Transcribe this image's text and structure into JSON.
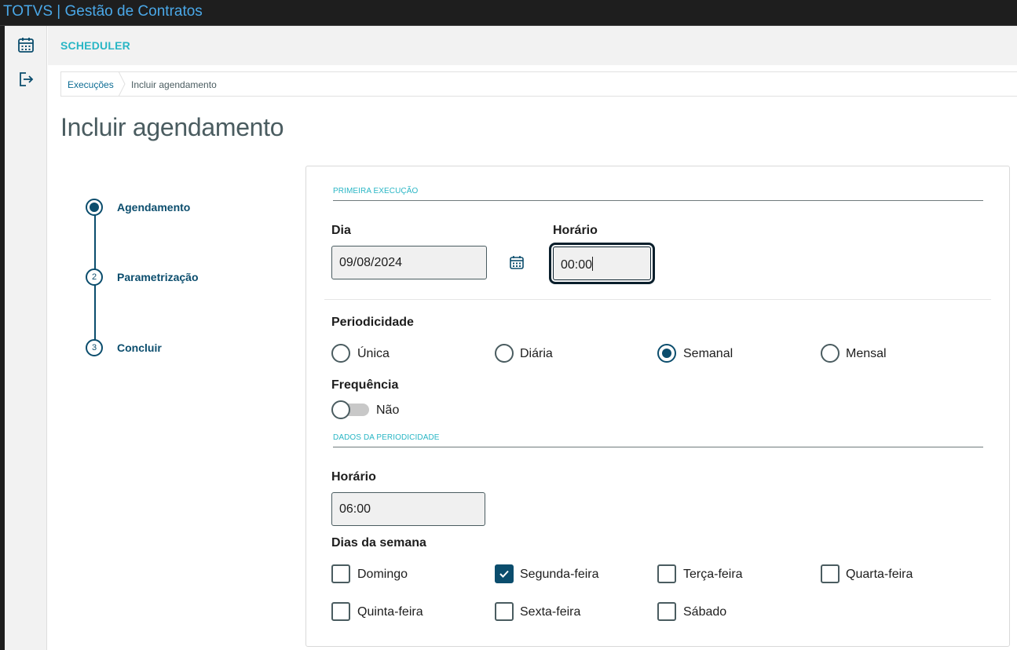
{
  "app": {
    "title": "TOTVS | Gestão de Contratos"
  },
  "sidebar": {
    "items": [
      {
        "icon": "calendar-icon"
      },
      {
        "icon": "logout-icon"
      }
    ]
  },
  "header": {
    "title": "SCHEDULER"
  },
  "breadcrumb": {
    "items": [
      "Execuções",
      "Incluir agendamento"
    ]
  },
  "page": {
    "title": "Incluir agendamento"
  },
  "stepper": {
    "steps": [
      {
        "number": "1",
        "label": "Agendamento",
        "state": "active"
      },
      {
        "number": "2",
        "label": "Parametrização",
        "state": "pending"
      },
      {
        "number": "3",
        "label": "Concluir",
        "state": "pending"
      }
    ]
  },
  "form": {
    "first_execution": {
      "section_title": "PRIMEIRA EXECUÇÃO",
      "day_label": "Dia",
      "day_value": "09/08/2024",
      "time_label": "Horário",
      "time_value": "00:00"
    },
    "periodicity": {
      "label": "Periodicidade",
      "options": [
        "Única",
        "Diária",
        "Semanal",
        "Mensal"
      ],
      "selected": "Semanal"
    },
    "frequency": {
      "label": "Frequência",
      "toggle_value": "Não"
    },
    "periodicity_data": {
      "section_title": "DADOS DA PERIODICIDADE",
      "time_label": "Horário",
      "time_value": "06:00",
      "weekdays_label": "Dias da semana",
      "weekdays": [
        {
          "label": "Domingo",
          "checked": false
        },
        {
          "label": "Segunda-feira",
          "checked": true
        },
        {
          "label": "Terça-feira",
          "checked": false
        },
        {
          "label": "Quarta-feira",
          "checked": false
        },
        {
          "label": "Quinta-feira",
          "checked": false
        },
        {
          "label": "Sexta-feira",
          "checked": false
        },
        {
          "label": "Sábado",
          "checked": false
        }
      ]
    }
  },
  "colors": {
    "primary": "#0b4d6d",
    "accent": "#29b6c5",
    "link": "#0c6c94",
    "title_bar_text": "#4aa8e8"
  }
}
